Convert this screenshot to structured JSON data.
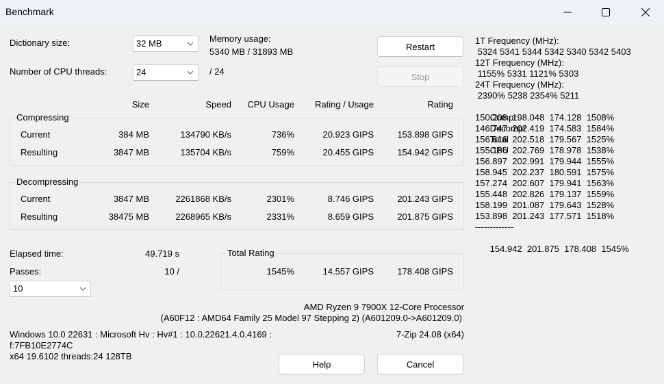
{
  "window": {
    "title": "Benchmark",
    "controls": {
      "minimize": "minimize-icon",
      "maximize": "maximize-icon",
      "close": "close-icon"
    }
  },
  "settings": {
    "dictionary_label": "Dictionary size:",
    "dictionary_value": "32 MB",
    "threads_label": "Number of CPU threads:",
    "threads_value": "24",
    "threads_max": "/ 24",
    "memory_label": "Memory usage:",
    "memory_value": "5340 MB / 31893 MB"
  },
  "buttons": {
    "restart": "Restart",
    "stop": "Stop",
    "help": "Help",
    "cancel": "Cancel"
  },
  "table": {
    "headers": [
      "Size",
      "Speed",
      "CPU Usage",
      "Rating / Usage",
      "Rating"
    ],
    "compressing": {
      "title": "Compressing",
      "rows": [
        {
          "label": "Current",
          "size": "384 MB",
          "speed": "134790 KB/s",
          "cpu": "736%",
          "rating_usage": "20.923 GIPS",
          "rating": "153.898 GIPS"
        },
        {
          "label": "Resulting",
          "size": "3847 MB",
          "speed": "135704 KB/s",
          "cpu": "759%",
          "rating_usage": "20.455 GIPS",
          "rating": "154.942 GIPS"
        }
      ]
    },
    "decompressing": {
      "title": "Decompressing",
      "rows": [
        {
          "label": "Current",
          "size": "3847 MB",
          "speed": "2261868 KB/s",
          "cpu": "2301%",
          "rating_usage": "8.746 GIPS",
          "rating": "201.243 GIPS"
        },
        {
          "label": "Resulting",
          "size": "38475 MB",
          "speed": "2268965 KB/s",
          "cpu": "2331%",
          "rating_usage": "8.659 GIPS",
          "rating": "201.875 GIPS"
        }
      ]
    }
  },
  "status": {
    "elapsed_label": "Elapsed time:",
    "elapsed_value": "49.719 s",
    "passes_label": "Passes:",
    "passes_value": "10 /",
    "passes_select": "10"
  },
  "total_rating": {
    "title": "Total Rating",
    "cpu": "1545%",
    "rating_usage": "14.557 GIPS",
    "rating": "178.408 GIPS"
  },
  "cpu_info": {
    "name": "AMD Ryzen 9 7900X 12-Core Processor",
    "details": "(A60F12 : AMD64 Family 25 Model 97 Stepping 2) (A601209.0->A601209.0)"
  },
  "system_info": {
    "line1": "Windows 10.0 22631 : Microsoft Hv : Hv#1 : 10.0.22621.4.0.4169 :",
    "line2": "f:7FB10E2774C",
    "line3": "x64 19.6102 threads:24 128TB",
    "version": "7-Zip 24.08 (x64)"
  },
  "frequency": {
    "t1_label": "1T Frequency (MHz):",
    "t1_values": " 5324 5341 5344 5342 5340 5342 5403",
    "t12_label": "12T Frequency (MHz):",
    "t12_values": " 1155% 5331 1121% 5303",
    "t24_label": "24T Frequency (MHz):",
    "t24_values": " 2390% 5238 2354% 5211"
  },
  "passes_log": {
    "headers": [
      "Compr",
      "Decompr",
      "Total",
      "CPU"
    ],
    "rows": [
      [
        "150.208",
        "198.048",
        "174.128",
        "1508%"
      ],
      [
        "146.747",
        "202.419",
        "174.583",
        "1584%"
      ],
      [
        "156.616",
        "202.518",
        "179.567",
        "1525%"
      ],
      [
        "155.186",
        "202.769",
        "178.978",
        "1538%"
      ],
      [
        "156.897",
        "202.991",
        "179.944",
        "1555%"
      ],
      [
        "158.945",
        "202.237",
        "180.591",
        "1575%"
      ],
      [
        "157.274",
        "202.607",
        "179.941",
        "1563%"
      ],
      [
        "155.448",
        "202.826",
        "179.137",
        "1559%"
      ],
      [
        "158.199",
        "201.087",
        "179.643",
        "1528%"
      ],
      [
        "153.898",
        "201.243",
        "177.571",
        "1518%"
      ]
    ],
    "separator": "-------------",
    "total": [
      "154.942",
      "201.875",
      "178.408",
      "1545%"
    ]
  }
}
